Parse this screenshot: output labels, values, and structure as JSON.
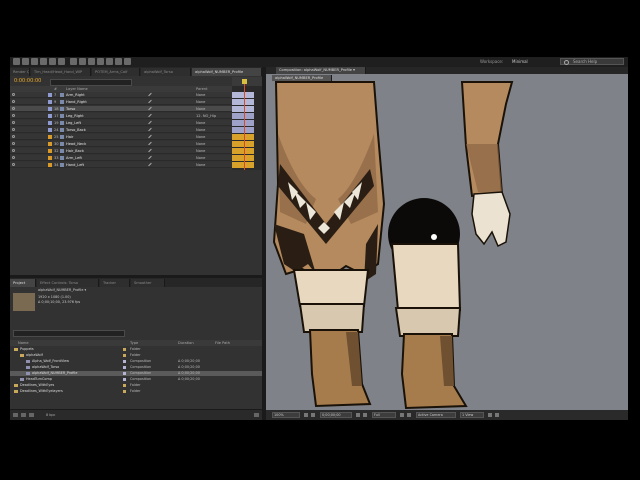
{
  "workspace": {
    "label": "Workspace:",
    "value": "Minimal",
    "search_placeholder": "Search Help"
  },
  "toolbar": {
    "tools": [
      "selection-tool",
      "hand-tool",
      "zoom-tool",
      "rotate-tool",
      "camera-tool",
      "pan-behind-tool",
      "pen-tool",
      "text-tool",
      "brush-tool",
      "clone-stamp-tool",
      "eraser-tool",
      "roto-brush-tool",
      "puppet-tool"
    ]
  },
  "timeline": {
    "tabs": [
      "Render Queue",
      "Tim_Head/Head_Hand_WIP",
      "POTEM_Arms_Calf",
      "alphaWolf_Torso",
      "alphaWolf_NUMBER_Profile"
    ],
    "timecode": "0:00:00:00",
    "headers": {
      "num": "#",
      "name": "Layer Name",
      "parent": "Parent"
    },
    "layers": [
      {
        "num": "7",
        "name": "Arm_Right",
        "parent": "None",
        "color": "#8f9ad0",
        "bar": "#b4b8d8"
      },
      {
        "num": "9",
        "name": "Hand_Right",
        "parent": "None",
        "color": "#8f9ad0",
        "bar": "#b4b8d8"
      },
      {
        "num": "18",
        "name": "Torso",
        "parent": "None",
        "color": "#8f9ad0",
        "bar": "#b4b8d8"
      },
      {
        "num": "17",
        "name": "Leg_Right",
        "parent": "12. NO_Hip",
        "color": "#8f9ad0",
        "bar": "#9ea2c8"
      },
      {
        "num": "19",
        "name": "Leg_Left",
        "parent": "None",
        "color": "#8f9ad0",
        "bar": "#9ea2c8"
      },
      {
        "num": "24",
        "name": "Torso_Back",
        "parent": "None",
        "color": "#8f9ad0",
        "bar": "#9ea2c8"
      },
      {
        "num": "25",
        "name": "Hair",
        "parent": "None",
        "color": "#d89a28",
        "bar": "#d8a22a"
      },
      {
        "num": "30",
        "name": "Head_Neck",
        "parent": "None",
        "color": "#d89a28",
        "bar": "#d8a22a"
      },
      {
        "num": "32",
        "name": "Hair_Back",
        "parent": "None",
        "color": "#d89a28",
        "bar": "#d8a22a"
      },
      {
        "num": "33",
        "name": "Arm_Left",
        "parent": "None",
        "color": "#d89a28",
        "bar": "#d8a22a"
      },
      {
        "num": "34",
        "name": "Hand_Left",
        "parent": "None",
        "color": "#d89a28",
        "bar": "#d8a22a"
      }
    ]
  },
  "project": {
    "tabs": [
      "Project",
      "Effect Controls: Torso",
      "Tracker",
      "Smoother"
    ],
    "preview_name": "alphaWolf_NUMBER_Profile ▾",
    "preview_info": "1920 x 1080 (1.00)\nΔ 0;00;10;00, 23.976 fps",
    "headers": {
      "name": "Name",
      "type": "Type",
      "duration": "Duration",
      "path": "File Path"
    },
    "rows": [
      {
        "name": "Puppets",
        "type": "Folder",
        "duration": "",
        "indent": 0,
        "kind": "folder",
        "color": "#c8a85a"
      },
      {
        "name": "alphaWolf",
        "type": "Folder",
        "duration": "",
        "indent": 1,
        "kind": "folder",
        "color": "#c8a85a"
      },
      {
        "name": "Alpha_Wolf_FrontView",
        "type": "Composition",
        "duration": "Δ 0;00;20;00",
        "indent": 2,
        "kind": "comp",
        "color": "#b4b4d4"
      },
      {
        "name": "alphaWolf_Torso",
        "type": "Composition",
        "duration": "Δ 0;00;20;00",
        "indent": 2,
        "kind": "comp",
        "color": "#b4b4d4"
      },
      {
        "name": "alphaWolf_NUMBER_Profile",
        "type": "Composition",
        "duration": "Δ 0;00;20;00",
        "indent": 2,
        "kind": "comp",
        "color": "#b4b4d4",
        "selected": true
      },
      {
        "name": "HeadTurnComp",
        "type": "Composition",
        "duration": "Δ 0;00;20;00",
        "indent": 1,
        "kind": "comp",
        "color": "#b4b4d4"
      },
      {
        "name": "Deadlines_WithEyes",
        "type": "Folder",
        "duration": "",
        "indent": 0,
        "kind": "folder",
        "color": "#c8a85a"
      },
      {
        "name": "Deadlines_WithEyelayers",
        "type": "Folder",
        "duration": "",
        "indent": 0,
        "kind": "folder",
        "color": "#c8a85a"
      }
    ],
    "bpc": "8 bpc"
  },
  "viewer": {
    "tab": "Composition: alphaWolf_NUMBER_Profile ▾",
    "breadcrumb": "alphaWolf_NUMBER_Profile",
    "zoom": "100%",
    "timecode": "0;00;00;00",
    "resolution": "Full",
    "camera": "Active Camera",
    "views": "1 View"
  }
}
